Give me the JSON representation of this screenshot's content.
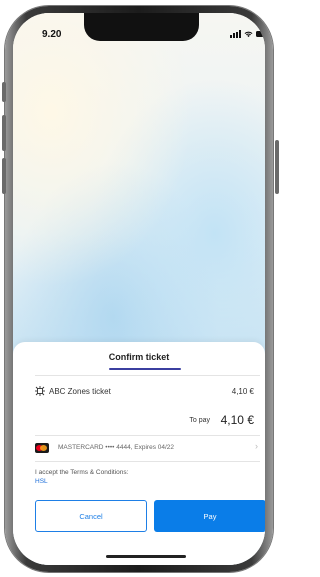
{
  "status_bar": {
    "time": "9.20"
  },
  "sheet": {
    "title": "Confirm ticket",
    "ticket": {
      "name": "ABC Zones ticket",
      "price": "4,10 €",
      "icon": "ticket-icon"
    },
    "to_pay": {
      "label": "To pay",
      "amount": "4,10 €"
    },
    "payment_method": {
      "text": "MASTERCARD •••• 4444, Expires 04/22",
      "icon": "mastercard-icon"
    },
    "terms": {
      "text": "I accept the Terms & Conditions:",
      "link": "HSL"
    },
    "buttons": {
      "cancel": "Cancel",
      "pay": "Pay"
    }
  },
  "colors": {
    "accent": "#0a7de8",
    "title_underline": "#3b3fa0",
    "link": "#1e6fd9"
  }
}
